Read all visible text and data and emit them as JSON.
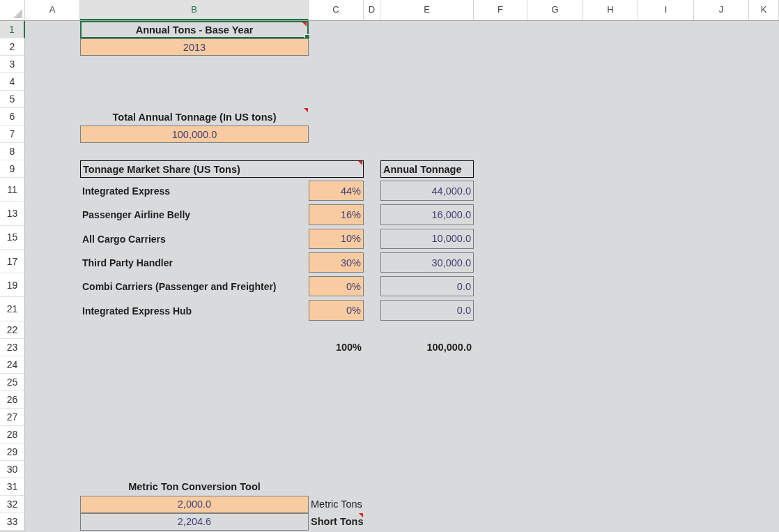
{
  "columns": [
    {
      "label": "A",
      "selected": false
    },
    {
      "label": "B",
      "selected": true
    },
    {
      "label": "C",
      "selected": false
    },
    {
      "label": "D",
      "selected": false
    },
    {
      "label": "E",
      "selected": false
    },
    {
      "label": "F",
      "selected": false
    },
    {
      "label": "G",
      "selected": false
    },
    {
      "label": "H",
      "selected": false
    },
    {
      "label": "I",
      "selected": false
    },
    {
      "label": "J",
      "selected": false
    },
    {
      "label": "K",
      "selected": false
    }
  ],
  "rows": [
    {
      "label": "1",
      "selected": true,
      "kind": "single",
      "cells": [
        {
          "kind": "title",
          "text": "Annual Tons  - Base Year",
          "selected": true,
          "comment": true
        }
      ]
    },
    {
      "label": "2",
      "selected": false,
      "kind": "single",
      "cells": [
        {
          "kind": "input",
          "text": "2013",
          "selected": false,
          "comment": false
        }
      ]
    },
    {
      "label": "3",
      "selected": false,
      "kind": "empty",
      "cells": []
    },
    {
      "label": "4",
      "selected": false,
      "kind": "empty",
      "cells": []
    },
    {
      "label": "5",
      "selected": false,
      "kind": "empty",
      "cells": []
    },
    {
      "label": "6",
      "selected": false,
      "kind": "single",
      "cells": [
        {
          "kind": "title",
          "text": "Total Annual Tonnage (In US tons)",
          "selected": false,
          "comment": true
        }
      ]
    },
    {
      "label": "7",
      "selected": false,
      "kind": "single",
      "cells": [
        {
          "kind": "input",
          "text": "100,000.0",
          "selected": false,
          "comment": false
        }
      ]
    },
    {
      "label": "8",
      "selected": false,
      "kind": "empty",
      "cells": []
    },
    {
      "label": "9",
      "selected": false,
      "kind": "table-head",
      "cells": [
        {
          "kind": "boxed",
          "text": "Tonnage Market Share (US Tons)",
          "selected": false,
          "comment": true
        },
        {
          "kind": "boxed",
          "text": "Annual Tonnage",
          "selected": false,
          "comment": false
        }
      ]
    },
    {
      "label": "11",
      "selected": false,
      "kind": "share",
      "cells": [
        {
          "kind": "label",
          "text": "Integrated Express",
          "selected": false,
          "comment": false
        },
        {
          "kind": "share",
          "text": "44%",
          "selected": false,
          "comment": false
        },
        {
          "kind": "output",
          "text": "44,000.0",
          "selected": false,
          "comment": false
        }
      ]
    },
    {
      "label": "13",
      "selected": false,
      "kind": "share",
      "cells": [
        {
          "kind": "label",
          "text": "Passenger Airline Belly",
          "selected": false,
          "comment": false
        },
        {
          "kind": "share",
          "text": "16%",
          "selected": false,
          "comment": false
        },
        {
          "kind": "output",
          "text": "16,000.0",
          "selected": false,
          "comment": false
        }
      ]
    },
    {
      "label": "15",
      "selected": false,
      "kind": "share",
      "cells": [
        {
          "kind": "label",
          "text": "All Cargo Carriers",
          "selected": false,
          "comment": false
        },
        {
          "kind": "share",
          "text": "10%",
          "selected": false,
          "comment": false
        },
        {
          "kind": "output",
          "text": "10,000.0",
          "selected": false,
          "comment": false
        }
      ]
    },
    {
      "label": "17",
      "selected": false,
      "kind": "share",
      "cells": [
        {
          "kind": "label",
          "text": "Third Party Handler",
          "selected": false,
          "comment": false
        },
        {
          "kind": "share",
          "text": "30%",
          "selected": false,
          "comment": false
        },
        {
          "kind": "output",
          "text": "30,000.0",
          "selected": false,
          "comment": false
        }
      ]
    },
    {
      "label": "19",
      "selected": false,
      "kind": "share",
      "cells": [
        {
          "kind": "label",
          "text": "Combi Carriers (Passenger and Freighter)",
          "selected": false,
          "comment": false
        },
        {
          "kind": "share",
          "text": "0%",
          "selected": false,
          "comment": false
        },
        {
          "kind": "output",
          "text": "0.0",
          "selected": false,
          "comment": false
        }
      ]
    },
    {
      "label": "21",
      "selected": false,
      "kind": "share",
      "cells": [
        {
          "kind": "label",
          "text": "Integrated Express Hub",
          "selected": false,
          "comment": false
        },
        {
          "kind": "share",
          "text": "0%",
          "selected": false,
          "comment": false
        },
        {
          "kind": "output",
          "text": "0.0",
          "selected": false,
          "comment": false
        }
      ]
    },
    {
      "label": "22",
      "selected": false,
      "kind": "empty",
      "cells": []
    },
    {
      "label": "23",
      "selected": false,
      "kind": "total",
      "cells": [
        {
          "kind": "total",
          "text": "100%",
          "selected": false,
          "comment": false
        },
        {
          "kind": "total",
          "text": "100,000.0",
          "selected": false,
          "comment": false
        }
      ]
    },
    {
      "label": "24",
      "selected": false,
      "kind": "empty",
      "cells": []
    },
    {
      "label": "25",
      "selected": false,
      "kind": "empty",
      "cells": []
    },
    {
      "label": "26",
      "selected": false,
      "kind": "empty",
      "cells": []
    },
    {
      "label": "27",
      "selected": false,
      "kind": "empty",
      "cells": []
    },
    {
      "label": "28",
      "selected": false,
      "kind": "empty",
      "cells": []
    },
    {
      "label": "29",
      "selected": false,
      "kind": "empty",
      "cells": []
    },
    {
      "label": "30",
      "selected": false,
      "kind": "empty",
      "cells": []
    },
    {
      "label": "31",
      "selected": false,
      "kind": "single",
      "cells": [
        {
          "kind": "title",
          "text": "Metric Ton Conversion Tool",
          "selected": false,
          "comment": false
        }
      ]
    },
    {
      "label": "32",
      "selected": false,
      "kind": "value-unit",
      "cells": [
        {
          "kind": "input",
          "text": "2,000.0",
          "selected": false,
          "comment": false
        },
        {
          "kind": "unit",
          "text": "Metric Tons",
          "selected": false,
          "comment": false
        }
      ]
    },
    {
      "label": "33",
      "selected": false,
      "kind": "value-unit",
      "cells": [
        {
          "kind": "result",
          "text": "2,204.6",
          "selected": false,
          "comment": false
        },
        {
          "kind": "unit-bold",
          "text": "Short Tons",
          "selected": false,
          "comment": true
        }
      ]
    }
  ]
}
